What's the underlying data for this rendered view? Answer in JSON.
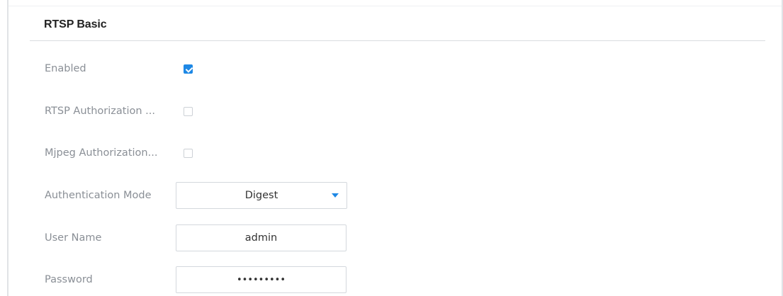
{
  "section": {
    "title": "RTSP Basic"
  },
  "fields": {
    "enabled": {
      "label": "Enabled",
      "checked": true
    },
    "rtsp_authorization": {
      "label": "RTSP Authorization ...",
      "checked": false
    },
    "mjpeg_authorization": {
      "label": "Mjpeg Authorization...",
      "checked": false
    },
    "authentication_mode": {
      "label": "Authentication Mode",
      "value": "Digest"
    },
    "user_name": {
      "label": "User Name",
      "value": "admin"
    },
    "password": {
      "label": "Password",
      "value": "•••••••••"
    }
  },
  "icons": {
    "checkbox_checked": "check-icon",
    "dropdown": "caret-down-icon"
  },
  "colors": {
    "accent": "#1e88e5",
    "label": "#8a8f96",
    "border": "#d4d8dd"
  }
}
